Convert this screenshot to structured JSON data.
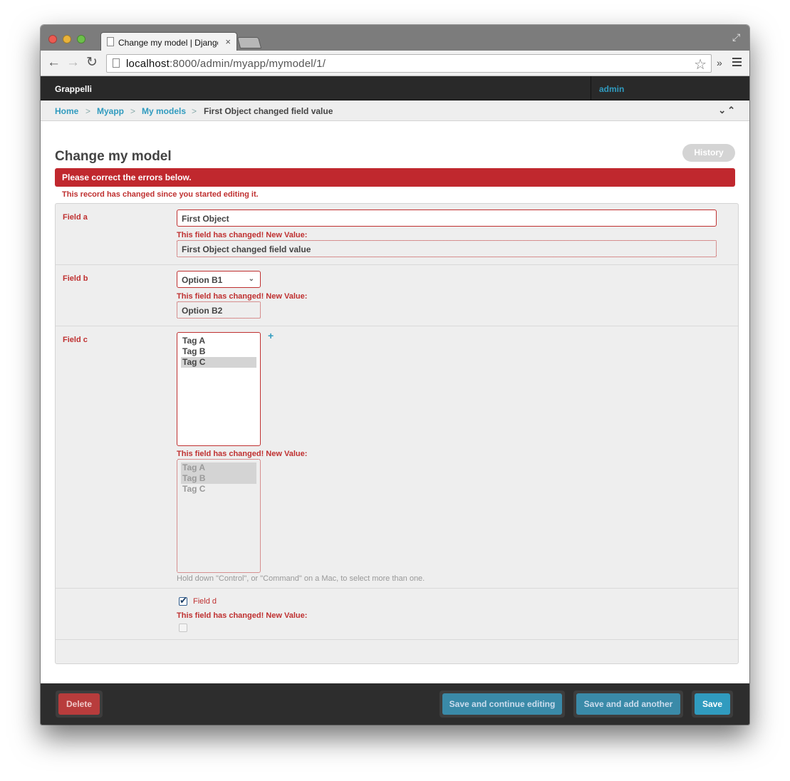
{
  "browser": {
    "tab_title": "Change my model | Django",
    "tab_close": "×",
    "url_host": "localhost",
    "url_rest": ":8000/admin/myapp/mymodel/1/",
    "overflow": "»"
  },
  "header": {
    "brand": "Grappelli",
    "user": "admin"
  },
  "breadcrumbs": {
    "items": [
      "Home",
      "Myapp",
      "My models"
    ],
    "separator": ">",
    "current": "First Object changed field value"
  },
  "page": {
    "title": "Change my model",
    "history": "History",
    "error_note": "Please correct the errors below.",
    "changed_note": "This record has changed since you started editing it."
  },
  "fields": {
    "changed_msg": "This field has changed! New Value:",
    "a": {
      "label": "Field a",
      "value": "First Object",
      "new_value": "First Object changed field value"
    },
    "b": {
      "label": "Field b",
      "value": "Option B1",
      "new_value": "Option B2"
    },
    "c": {
      "label": "Field c",
      "options": [
        "Tag A",
        "Tag B",
        "Tag C"
      ],
      "selected": [
        false,
        false,
        true
      ],
      "new_selected": [
        true,
        true,
        false
      ],
      "add": "+",
      "help": "Hold down \"Control\", or \"Command\" on a Mac, to select more than one."
    },
    "d": {
      "label": "Field d",
      "checked": true,
      "new_checked": false
    }
  },
  "footer": {
    "delete": "Delete",
    "save_continue": "Save and continue editing",
    "save_add": "Save and add another",
    "save": "Save"
  }
}
